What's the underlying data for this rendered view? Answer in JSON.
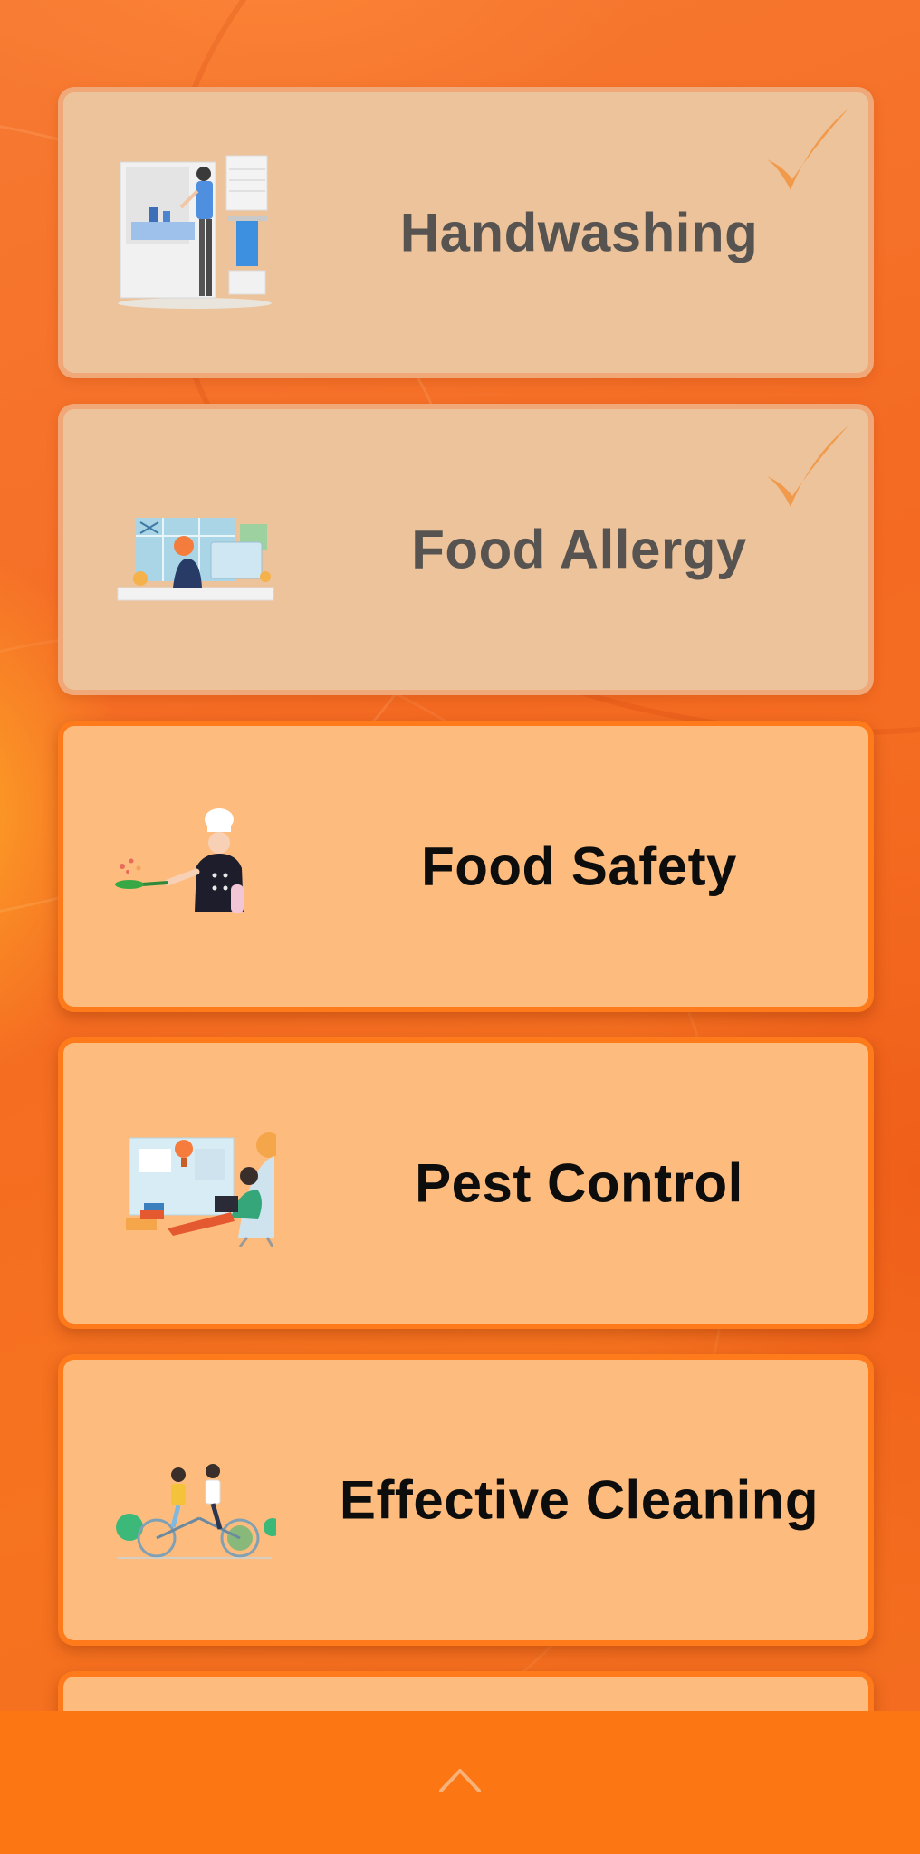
{
  "colors": {
    "background": "#f46a22",
    "card_completed_bg": "#ecc39b",
    "card_pending_bg": "#fdbc7d",
    "card_pending_border": "#ff7a1a",
    "checkmark": "#f19a4c",
    "bottom_bar": "#fc7614"
  },
  "modules": [
    {
      "title": "Handwashing",
      "status": "completed",
      "illustration": "handwashing-illustration"
    },
    {
      "title": "Food Allergy",
      "status": "completed",
      "illustration": "food-allergy-illustration"
    },
    {
      "title": "Food Safety",
      "status": "pending",
      "illustration": "chef-illustration"
    },
    {
      "title": "Pest Control",
      "status": "pending",
      "illustration": "pest-control-illustration"
    },
    {
      "title": "Effective Cleaning",
      "status": "pending",
      "illustration": "tandem-bicycle-illustration"
    }
  ],
  "bottom_bar": {
    "icon": "chevron-up-icon"
  }
}
